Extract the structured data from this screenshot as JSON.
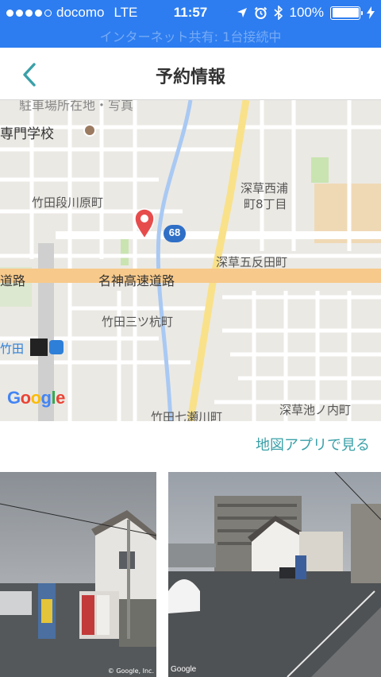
{
  "status_bar": {
    "carrier": "docomo",
    "network": "LTE",
    "time": "11:57",
    "battery": "100%",
    "signal_bars": 4,
    "battery_level": 1.0
  },
  "hotspot_banner": "インターネット共有: 1台接続中",
  "nav": {
    "title": "予約情報",
    "back_icon": "chevron-left-icon"
  },
  "section_label": "駐車場所在地・写真",
  "map": {
    "labels": [
      "専門学校",
      "竹田段川原町",
      "深草西浦",
      "町8丁目",
      "深草五反田町",
      "道路",
      "名神高速道路",
      "竹田三ツ杭町",
      "竹田",
      "深草池ノ内町",
      "竹田七瀬川町"
    ],
    "route_badge": "68",
    "marker_icon": "map-pin-icon",
    "google_logo": [
      "G",
      "o",
      "o",
      "g",
      "l",
      "e"
    ]
  },
  "map_link": "地図アプリで見る",
  "photos": {
    "photo1_copyright": "© Google, Inc.",
    "photo2_brand": "Google"
  },
  "colors": {
    "status_bar": "#2d7df0",
    "accent": "#3aa0a8",
    "highway": "#f7c98a",
    "marker": "#e74c4c"
  }
}
